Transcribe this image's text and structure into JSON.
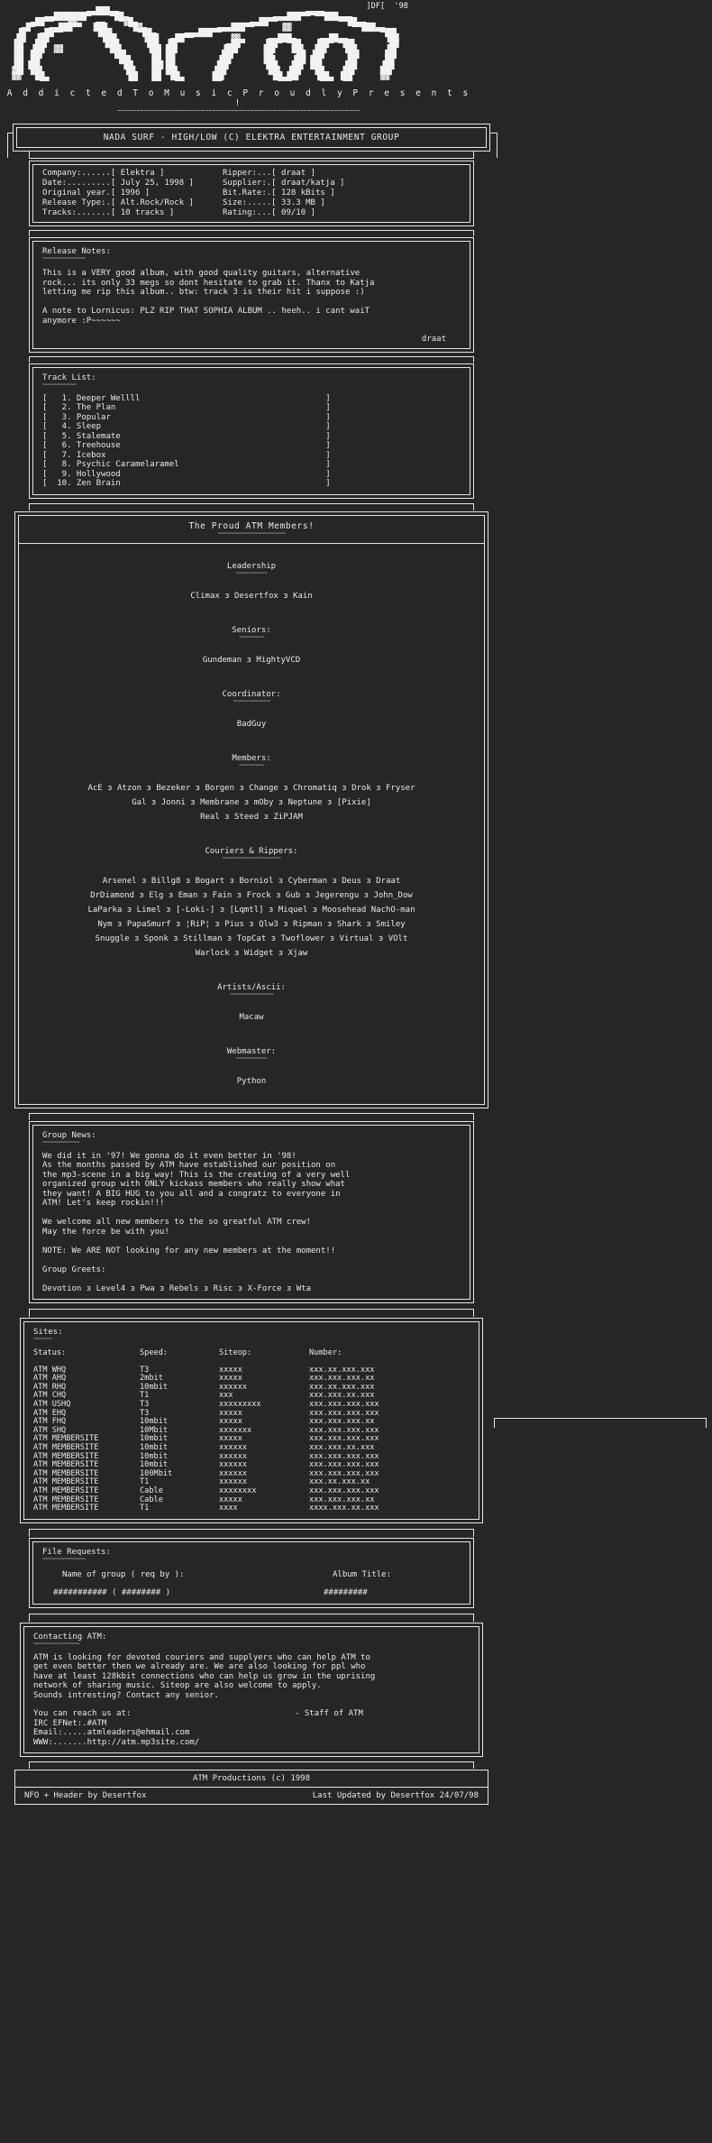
{
  "logo": {
    "ascii": [
      "                                                                             ]DF[  '98",
      "                 ▄▄███▄▄                                        ▄▄▄▄                ",
      "        ▄▄███████▀    ▀██▄                               ▄▄▄███▀▀ ▀▀███▄▄▄          ",
      "     ▄██▀▀   ▓▓    ▄▄   ▀▓█▄                        ▄▄██▀▀             ▀▀██▄▄       ",
      "   ▄█▀   ▄▄███▀▀  ▐██▌    ▀█▓▄               ▄▄▄███▀▀      ▓▓             ▀▀███▄▄   ",
      "  ▐█   ▄██▀▀       ▐██▌     ▀██▄      ▄▄▄███▀▀                                  ▀██▌",
      "  ██  ▐██           ▐██▌     ▐██▌  ▄██▀▀        ▓▓      ▄▄███▄     ▄▄██▄▄        ▐██",
      " ▐█▌  ██▌            ███      ██▌ ▐█▌          ▄██▀    ▐██▀ ▀██   ▐██▀ ▀██▌       ██",
      " ▐█▌ ▐██  ▓▓          ██▌     ▐██ ██▌         ▐██▌     ██▌   ██▌  ██▌   ▐██      ▐█▌",
      " ▐█▌ ██▌               ██▌     ██ ██          ██▌      ██     ██ ▐██     ██▌     ██▌",
      " ▐█▌ ██                 ██▌    ██ ██         ▐██       ██▌   ▐██ ██▌     ██      ██ ",
      " ▐█▌▐██                  ██    ██▌██         ██▌       ▐██   ██▌ ██▌    ▐██     ▐██ ",
      " ▓█▌ ██▌                 ▐█▌   ██ ██▌       ▐██         ██▌ ▐██   ██    ██▌     ██▌ ",
      " ▓▓   ██                  ██   ██  ██       ██▌          ██ ██▌   ▐██  ▐██      ▓▓  ",
      "       ▀▀                 ▀▀   ▀▀   ▀▀      ▀▀            ▀▀▀      ▀▀▀  ▀▀           "
    ],
    "year_tag": "]DF[  '98",
    "tagline": "A d d i c t e d  T o  M u s i c  P r o u d l y  P r e s e n t s !"
  },
  "release": {
    "title": "NADA SURF - HIGH/LOW (C) ELEKTRA ENTERTAINMENT GROUP",
    "fields_left": [
      {
        "label": "Company:......[",
        "value": "Elektra",
        "close": "]"
      },
      {
        "label": "Date:.........[",
        "value": "July 25, 1998",
        "close": "]"
      },
      {
        "label": "Original year.[",
        "value": "1996",
        "close": "]"
      },
      {
        "label": "Release Type:.[",
        "value": "Alt.Rock/Rock",
        "close": "]"
      },
      {
        "label": "Tracks:.......[",
        "value": "10 tracks",
        "close": "]"
      }
    ],
    "fields_right": [
      {
        "label": "Ripper:...[",
        "value": "draat",
        "close": "]"
      },
      {
        "label": "Supplier:.[",
        "value": "draat/katja",
        "close": "]"
      },
      {
        "label": "Bit.Rate:.[",
        "value": "128 kBits",
        "close": "]"
      },
      {
        "label": "Size:.....[",
        "value": "33.3 MB",
        "close": "]"
      },
      {
        "label": "Rating:...[",
        "value": "09/10",
        "close": "]"
      }
    ]
  },
  "release_notes": {
    "heading": "Release Notes:",
    "body": "This is a VERY good album, with good quality guitars, alternative\nrock... its only 33 megs so dont hesitate to grab it. Thanx to Katja\nletting me rip this album.. btw: track 3 is their hit i suppose :)\n\nA note to Lornicus: PLZ RIP THAT SOPHIA ALBUM .. heeh.. i cant waiT\nanymore :P~~~~~~",
    "signature": "draat"
  },
  "track_list": {
    "heading": "Track List:",
    "tracks": [
      {
        "open": "[",
        "num": "1.",
        "title": "Deeper Wellll",
        "close": "]"
      },
      {
        "open": "[",
        "num": "2.",
        "title": "The Plan",
        "close": "]"
      },
      {
        "open": "[",
        "num": "3.",
        "title": "Popular",
        "close": "]"
      },
      {
        "open": "[",
        "num": "4.",
        "title": "Sleep",
        "close": "]"
      },
      {
        "open": "[",
        "num": "5.",
        "title": "Stalemate",
        "close": "]"
      },
      {
        "open": "[",
        "num": "6.",
        "title": "Treehouse",
        "close": "]"
      },
      {
        "open": "[",
        "num": "7.",
        "title": "Icebox",
        "close": "]"
      },
      {
        "open": "[",
        "num": "8.",
        "title": "Psychic Caramelaramel",
        "close": "]"
      },
      {
        "open": "[",
        "num": "9.",
        "title": "Hollywood",
        "close": "]"
      },
      {
        "open": "[",
        "num": "10.",
        "title": "Zen Brain",
        "close": "]"
      }
    ]
  },
  "members": {
    "title": "The Proud ATM Members!",
    "sections": [
      {
        "heading": "Leadership",
        "rows": [
          "Climax з Desertfox з Kain"
        ]
      },
      {
        "heading": "Seniors:",
        "rows": [
          "Gundeman з MightyVCD"
        ]
      },
      {
        "heading": "Coordinator:",
        "rows": [
          "BadGuy"
        ]
      },
      {
        "heading": "Members:",
        "rows": [
          "AcE з Atzon з Bezeker з Borgen з Change з Chromatiq з Drok з Fryser",
          "Gal з Jonni з Membrane з mOby з Neptune з [Pixie]",
          "Real з Steed з ZiPJAM"
        ]
      },
      {
        "heading": "Couriers & Rippers:",
        "rows": [
          "Arsenel з Billg8 з Bogart з Borniol з Cyberman з Deus з Draat",
          "DrDiamond з Elg з Eman з Fain з Frock з Gub з Jegerengu з John_Dow",
          "LaParka з Limel з [-Loki-] з [Lqmtl] з Miquel з Moosehead NachO-man",
          "Nym з PapaSmurf з ¦RiP¦ з Pius з Qlw3 з Ripman з Shark з Smiley",
          "Snuggle з Sponk з Stillman з TopCat з Twoflower з Virtual з VOlt",
          "Warlock з Widget з Xjaw"
        ]
      },
      {
        "heading": "Artists/Ascii:",
        "rows": [
          "Macaw"
        ]
      },
      {
        "heading": "Webmaster:",
        "rows": [
          "Python"
        ]
      }
    ]
  },
  "group_news": {
    "heading": "Group News:",
    "body": "We did it in '97! We gonna do it even better in '98!\nAs the months passed by ATM have established our position on\nthe mp3-scene in a big way! This is the creating of a very well\norganized group with ONLY kickass members who really show what\nthey want! A BIG HUG to you all and a congratz to everyone in\nATM! Let's keep rockin!!!\n\nWe welcome all new members to the so greatful ATM crew!\nMay the force be with you!\n\nNOTE: We ARE NOT looking for any new members at the moment!!\n\nGroup Greets:\n\nDevotion з Level4 з Pwa з Rebels з Risc з X-Force з Wta"
  },
  "sites": {
    "heading": "Sites:",
    "columns": [
      "Status:",
      "Speed:",
      "Siteop:",
      "Number:"
    ],
    "rows": [
      [
        "ATM WHQ",
        "T3",
        "xxxxx",
        "xxx.xx.xxx.xxx"
      ],
      [
        "ATM AHQ",
        "2mbit",
        "xxxxx",
        "xxx.xxx.xxx.xx"
      ],
      [
        "ATM RHQ",
        "10mbit",
        "xxxxxx",
        "xxx.xx.xxx.xxx"
      ],
      [
        "ATM CHQ",
        "T1",
        "xxx",
        "xxx.xxx.xx.xxx"
      ],
      [
        "ATM USHQ",
        "T3",
        "xxxxxxxxx",
        "xxx.xxx.xxx.xxx"
      ],
      [
        "ATM EHQ",
        "T3",
        "xxxxx",
        "xxx.xxx.xxx.xxx"
      ],
      [
        "ATM FHQ",
        "10mbit",
        "xxxxx",
        "xxx.xxx.xxx.xx"
      ],
      [
        "ATM SHQ",
        "10Mbit",
        "xxxxxxx",
        "xxx.xxx.xxx.xxx"
      ],
      [
        "ATM MEMBERSITE",
        "10mbit",
        "xxxxx",
        "xxx.xxx.xxx.xxx"
      ],
      [
        "ATM MEMBERSITE",
        "10mbit",
        "xxxxxx",
        "xxx.xxx.xx.xxx"
      ],
      [
        "ATM MEMBERSITE",
        "10mbit",
        "xxxxxx",
        "xxx.xxx.xxx.xxx"
      ],
      [
        "ATM MEMBERSITE",
        "10mbit",
        "xxxxxx",
        "xxx.xxx.xxx.xxx"
      ],
      [
        "ATM MEMBERSITE",
        "100Mbit",
        "xxxxxx",
        "xxx.xxx.xxx.xxx"
      ],
      [
        "ATM MEMBERSITE",
        "T1",
        "xxxxxx",
        "xxx.xx.xxx.xx"
      ],
      [
        "ATM MEMBERSITE",
        "Cable",
        "xxxxxxxx",
        "xxx.xxx.xxx.xxx"
      ],
      [
        "ATM MEMBERSITE",
        "Cable",
        "xxxxx",
        "xxx.xxx.xxx.xx"
      ],
      [
        "ATM MEMBERSITE",
        "T1",
        "xxxx",
        "xxxx.xxx.xx.xxx"
      ]
    ]
  },
  "file_requests": {
    "heading": "File Requests:",
    "col_left": "Name of group ( req by ):",
    "col_right": "Album Title:",
    "value_left": "########### ( ######## )",
    "value_right": "#########"
  },
  "contact": {
    "heading": "Contacting ATM:",
    "body": "ATM is looking for devoted couriers and supplyers who can help ATM to\nget even better then we already are. We are also looking for ppl who\nhave at least 128kbit connections who can help us grow in the uprising\nnetwork of sharing music. Siteop are also welcome to apply.\nSounds intresting? Contact any senior.",
    "reach_label": "You can reach us at:",
    "staff": "- Staff of ATM",
    "lines": [
      "IRC EFNet:.#ATM",
      "Email:.....atmleaders@ehmail.com",
      "WWW:.......http://atm.mp3site.com/"
    ]
  },
  "footer": {
    "production": "ATM Productions (c) 1998",
    "left": "NFO + Header by Desertfox",
    "right": "Last Updated by Desertfox  24/07/98"
  }
}
